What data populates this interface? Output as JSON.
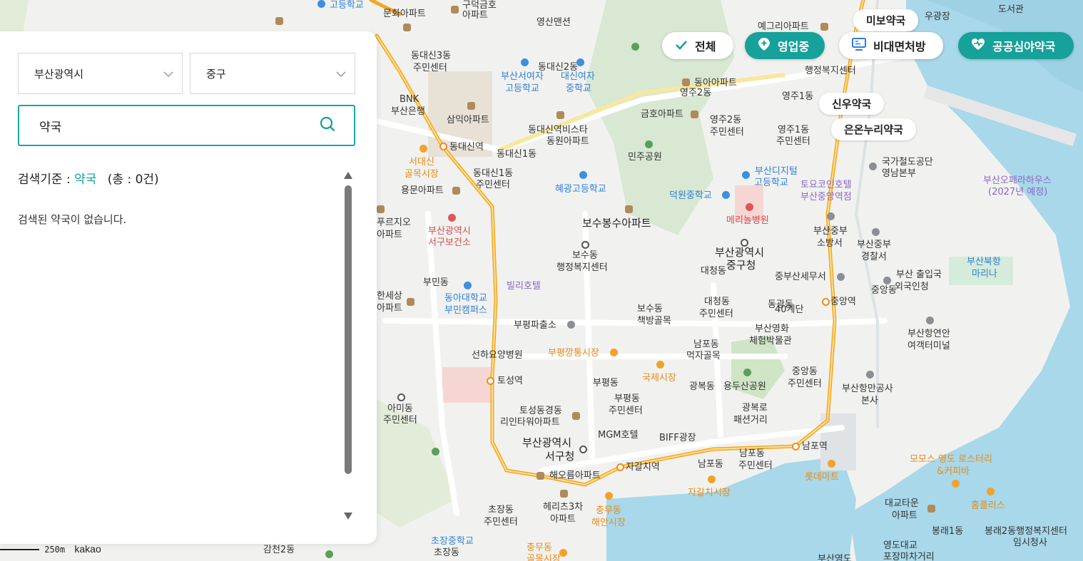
{
  "filters": {
    "city": "부산광역시",
    "district": "중구",
    "search_value": "약국",
    "criteria_prefix": "검색기준 : ",
    "criteria_keyword": "약국",
    "criteria_count": "(총 : 0건)",
    "empty_message": "검색된 약국이 없습니다."
  },
  "chips": {
    "all": "전체",
    "open": "영업중",
    "remote": "비대면처방",
    "night": "공공심야약국"
  },
  "pharmacies": [
    "미보약국",
    "신우약국",
    "은온누리약국"
  ],
  "map": {
    "scale": "250m",
    "brand": "kakao",
    "labels": [
      "고등학교",
      "문화아파트",
      "구덕금호",
      "아파트",
      "영산맨션",
      "동대신3동",
      "주민센터",
      "동대신2동",
      "부산서여자",
      "고등학교",
      "대신여자",
      "중학교",
      "BNK",
      "부산은행",
      "삼익아파트",
      "동대신역",
      "동대신역비스타",
      "동원아파트",
      "동대신1동",
      "동대신1동",
      "주민센터",
      "서대신",
      "골목시장",
      "용문아파트",
      "혜광고등학교",
      "민주공원",
      "금호아파트",
      "영주2동",
      "주민센터",
      "영주1동",
      "주민센터",
      "동아아파트",
      "영주2동",
      "영주1동",
      "예그리아파트",
      "행정복지센터",
      "부산디지털",
      "고등학교",
      "덕원중학교",
      "메리놀병원",
      "토요코인호텔",
      "부산중앙역점",
      "국가철도공단",
      "영남본부",
      "부산오페라하우스",
      "(2027년 예정)",
      "푸르지오",
      "아파트",
      "부산광역시",
      "서구보건소",
      "보수봉수아파트",
      "보수동",
      "행정복지센터",
      "부산광역시",
      "중구청",
      "대청동",
      "부산중부",
      "소방서",
      "부산중부",
      "경찰서",
      "부산북항",
      "마리나",
      "빌리호텔",
      "부민동",
      "동아대학교",
      "부민캠퍼스",
      "한세상",
      "아파트",
      "중부산세무서",
      "부산 출입국",
      "외국인청",
      "중앙동",
      "대청동",
      "주민센터",
      "동광동",
      "40계단",
      "중앙역",
      "보수동",
      "책방골목",
      "부평파출소",
      "부산영화",
      "체험박물관",
      "부산항연안",
      "여객터미널",
      "선하요양병원",
      "부평깡통시장",
      "국제시장",
      "남포동",
      "먹자골목",
      "중앙동",
      "주민센터",
      "부산항만공사",
      "본사",
      "토성역",
      "부평동",
      "부평동",
      "주민센터",
      "광복동",
      "용두산공원",
      "아미동",
      "주민센터",
      "토성동경동",
      "리인타워아파트",
      "광복로",
      "패션거리",
      "MGM호텔",
      "BIFF광장",
      "부산광역시",
      "서구청",
      "남포역",
      "남포동",
      "남포동",
      "주민센터",
      "자갈치역",
      "해오름아파트",
      "자갈치시장",
      "롯데마트",
      "모모스 영도 로스터리",
      "&커피바",
      "헤리츠3차",
      "아파트",
      "충무동",
      "해안시장",
      "초장동",
      "주민센터",
      "대교타운",
      "아파트",
      "홈플러스",
      "봉래1동",
      "봉래2동행정복지센터",
      "임시청사",
      "초장중학교",
      "초장동",
      "감천2동",
      "충무동",
      "골목시장",
      "부산영도",
      "영도대교",
      "포장마차거리",
      "도서관",
      "우광장"
    ]
  }
}
